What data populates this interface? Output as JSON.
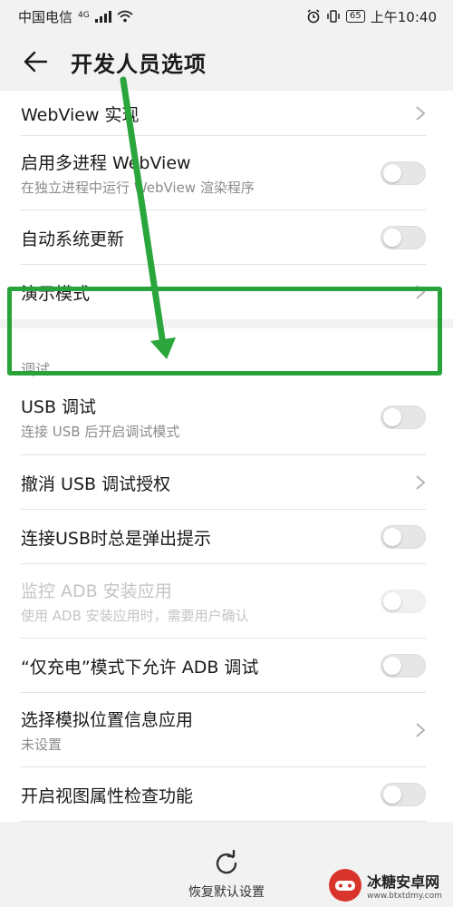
{
  "status_bar": {
    "carrier": "中国电信",
    "network": "4G",
    "battery": "65",
    "time": "上午10:40"
  },
  "header": {
    "title": "开发人员选项"
  },
  "settings": {
    "webview_impl": {
      "title": "WebView 实现"
    },
    "multiprocess_webview": {
      "title": "启用多进程 WebView",
      "subtitle": "在独立进程中运行 WebView 渲染程序"
    },
    "auto_update": {
      "title": "自动系统更新"
    },
    "demo_mode": {
      "title": "演示模式"
    }
  },
  "debug_section": {
    "title": "调试",
    "usb_debugging": {
      "title": "USB 调试",
      "subtitle": "连接 USB 后开启调试模式"
    },
    "revoke_usb": {
      "title": "撤消 USB 调试授权"
    },
    "usb_prompt": {
      "title": "连接USB时总是弹出提示"
    },
    "monitor_adb": {
      "title": "监控 ADB 安装应用",
      "subtitle": "使用 ADB 安装应用时，需要用户确认"
    },
    "charge_only_adb": {
      "title": "“仅充电”模式下允许 ADB 调试"
    },
    "mock_location": {
      "title": "选择模拟位置信息应用",
      "subtitle": "未设置"
    },
    "view_attr": {
      "title": "开启视图属性检查功能"
    }
  },
  "toggles": {
    "multiprocess_webview": false,
    "auto_update": false,
    "usb_debugging": false,
    "usb_prompt": false,
    "monitor_adb": false,
    "charge_only_adb": false,
    "view_attr": false
  },
  "bottom_bar": {
    "reset_label": "恢复默认设置"
  },
  "watermark": {
    "name": "冰糖安卓网",
    "url": "www.btxtdmy.com"
  },
  "colors": {
    "highlight": "#27a33a",
    "arrow": "#2aa63c"
  }
}
